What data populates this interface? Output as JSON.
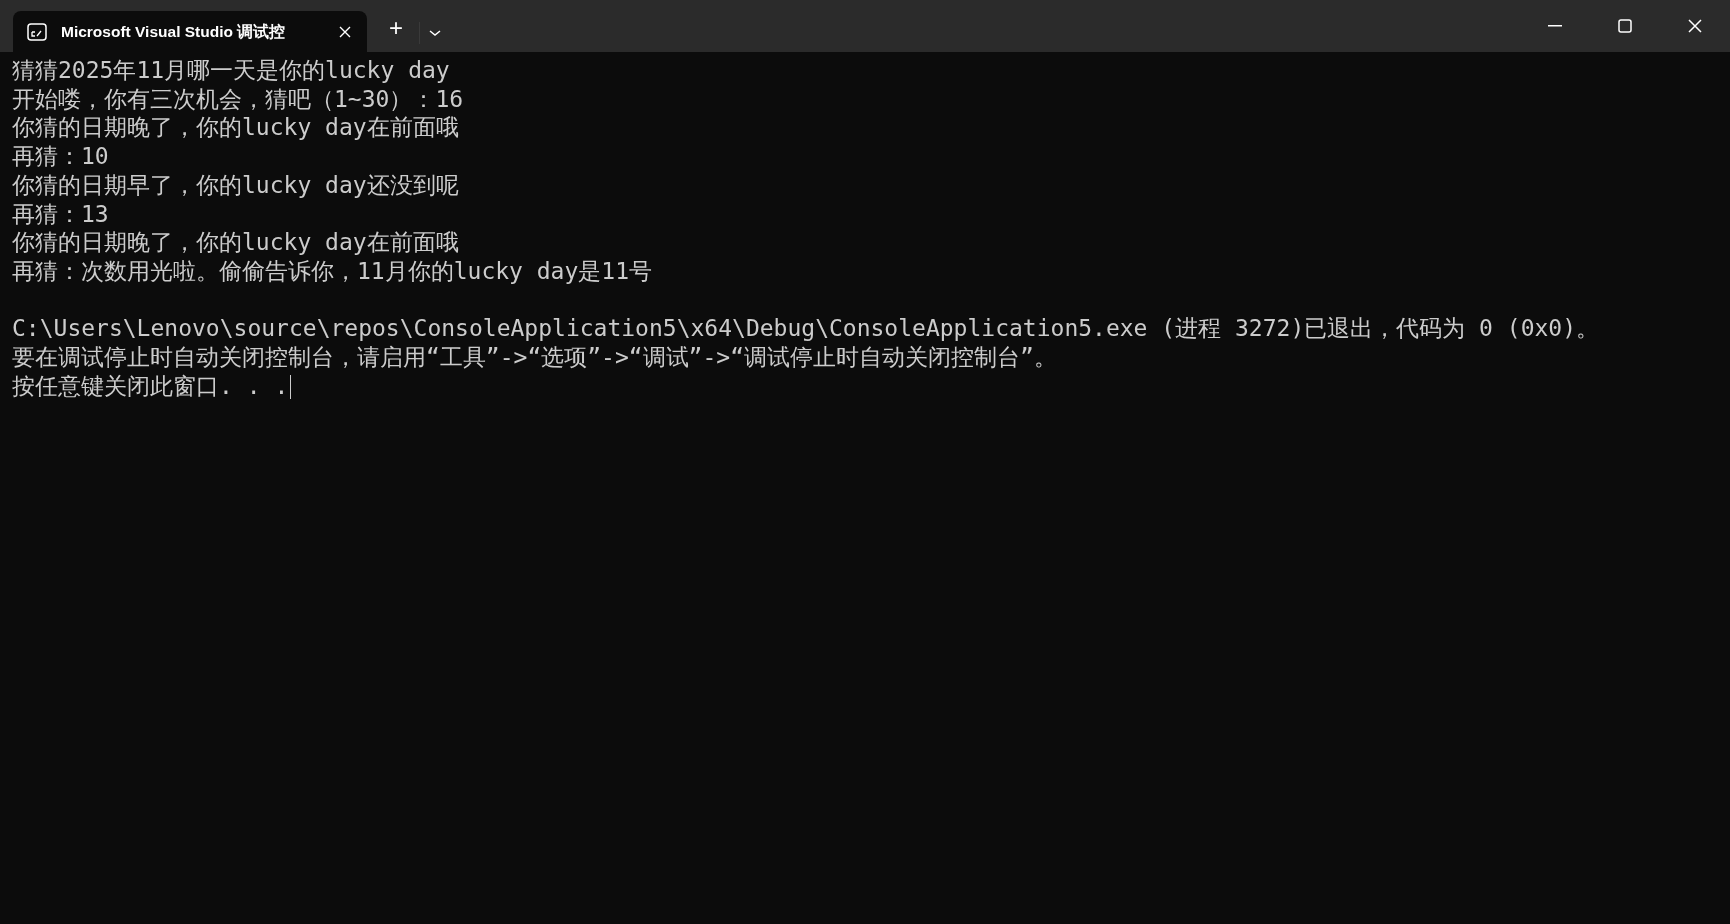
{
  "tabs": [
    {
      "title": "Microsoft Visual Studio 调试控",
      "selected": true
    }
  ],
  "new_tab": "+",
  "console": {
    "program_output": [
      "猜猜2025年11月哪一天是你的lucky day",
      "开始喽，你有三次机会，猜吧（1~30）：16",
      "你猜的日期晚了，你的lucky day在前面哦",
      "再猜：10",
      "你猜的日期早了，你的lucky day还没到呢",
      "再猜：13",
      "你猜的日期晚了，你的lucky day在前面哦",
      "再猜：次数用光啦。偷偷告诉你，11月你的lucky day是11号"
    ],
    "exit_messages": [
      "C:\\Users\\Lenovo\\source\\repos\\ConsoleApplication5\\x64\\Debug\\ConsoleApplication5.exe (进程 3272)已退出，代码为 0 (0x0)。",
      "要在调试停止时自动关闭控制台，请启用“工具”->“选项”->“调试”->“调试停止时自动关闭控制台”。",
      "按任意键关闭此窗口. . ."
    ],
    "cursor_visible": true
  }
}
